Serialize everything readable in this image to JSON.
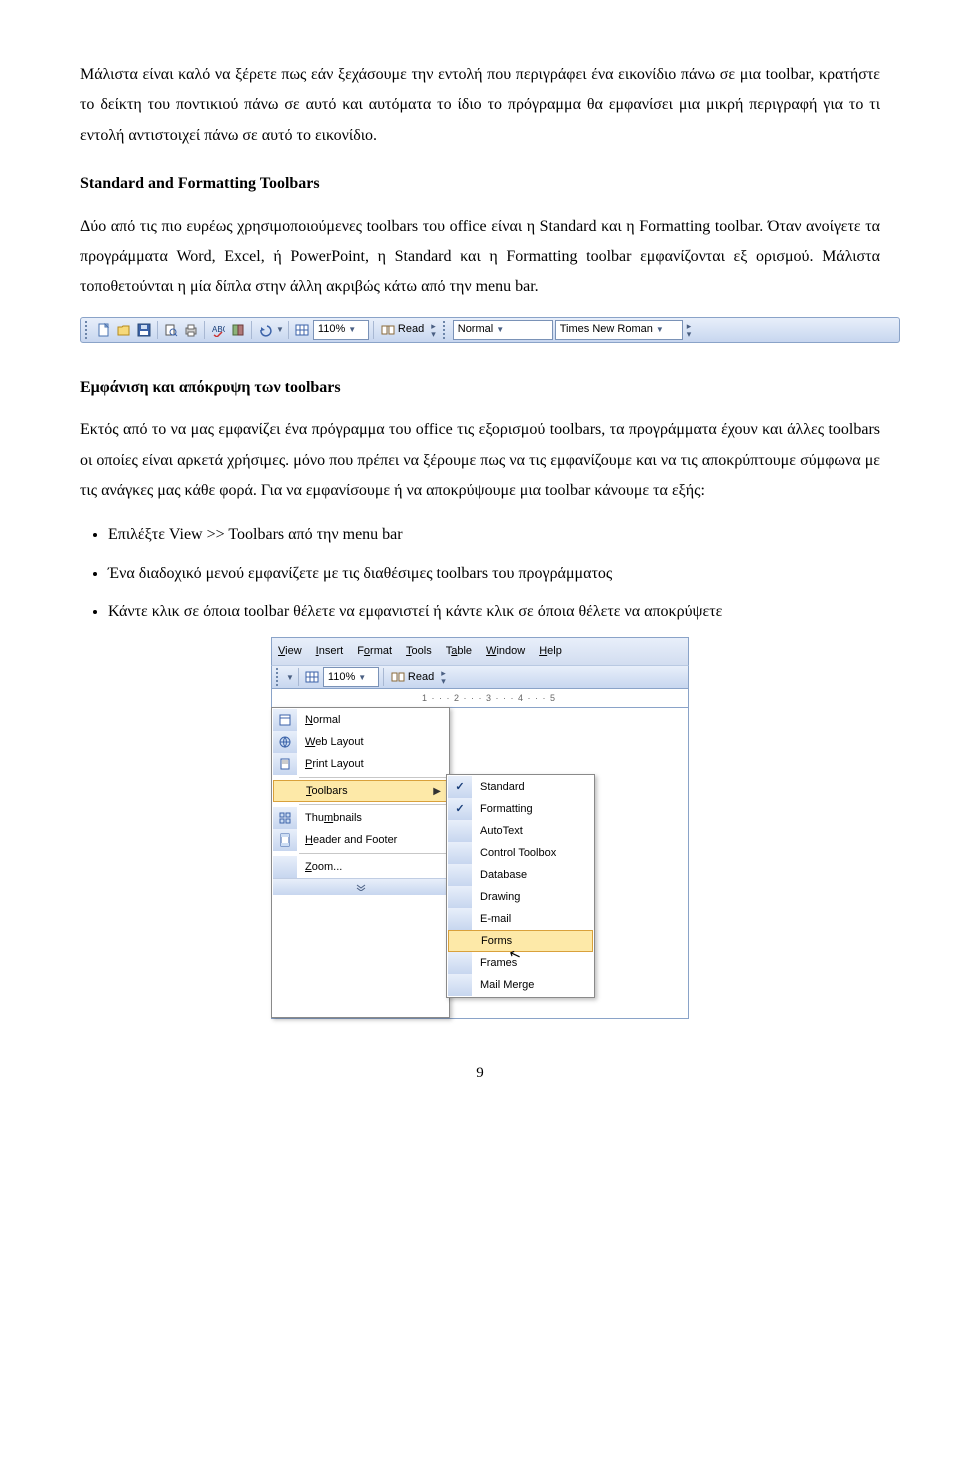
{
  "paragraphs": {
    "p1": "Μάλιστα είναι καλό να ξέρετε πως εάν ξεχάσουμε την εντολή που περιγράφει ένα εικονίδιο πάνω σε μια toolbar, κρατήστε το δείκτη του ποντικιού πάνω σε αυτό και αυτόματα το ίδιο το πρόγραμμα θα εμφανίσει μια μικρή περιγραφή για το τι εντολή αντιστοιχεί πάνω σε αυτό το εικονίδιο.",
    "heading1": "Standard and Formatting Toolbars",
    "p2": "Δύο από τις πιο ευρέως χρησιμοποιούμενες toolbars του office είναι η Standard και η Formatting toolbar. Όταν ανοίγετε τα προγράμματα Word, Excel, ή PowerPoint, η Standard και η Formatting toolbar εμφανίζονται εξ ορισμού. Μάλιστα τοποθετούνται η μία δίπλα στην άλλη ακριβώς κάτω από την menu bar.",
    "heading2": "Εμφάνιση και απόκρυψη των toolbars",
    "p3": "Εκτός από το να μας εμφανίζει ένα πρόγραμμα του office τις εξορισμού toolbars, τα προγράμματα έχουν και άλλες toolbars οι οποίες είναι αρκετά χρήσιμες. μόνο που πρέπει να ξέρουμε πως να τις εμφανίζουμε και να τις αποκρύπτουμε σύμφωνα με τις ανάγκες μας κάθε φορά. Για να εμφανίσουμε ή να αποκρύψουμε μια toolbar κάνουμε τα εξής:",
    "li1": "Επιλέξτε View >> Toolbars από την menu bar",
    "li2": "Ένα διαδοχικό μενού εμφανίζετε με τις διαθέσιμες toolbars του προγράμματος",
    "li3": "Κάντε κλικ σε όποια toolbar θέλετε να εμφανιστεί ή κάντε κλικ σε όποια θέλετε να αποκρύψετε"
  },
  "toolbar": {
    "zoom": "110%",
    "read": "Read",
    "style": "Normal",
    "font": "Times New Roman"
  },
  "menubar": {
    "view": "View",
    "insert": "Insert",
    "format": "Format",
    "tools": "Tools",
    "table": "Table",
    "window": "Window",
    "help": "Help"
  },
  "mini_toolbar": {
    "zoom": "110%",
    "read": "Read"
  },
  "ruler": "1 · · · 2 · · · 3 · · · 4 · · · 5",
  "view_menu": {
    "normal": "Normal",
    "web": "Web Layout",
    "print": "Print Layout",
    "toolbars": "Toolbars",
    "thumbs": "Thumbnails",
    "headerfooter": "Header and Footer",
    "zoom": "Zoom..."
  },
  "submenu": {
    "standard": "Standard",
    "formatting": "Formatting",
    "autotext": "AutoText",
    "controltoolbox": "Control Toolbox",
    "database": "Database",
    "drawing": "Drawing",
    "email": "E-mail",
    "forms": "Forms",
    "frames": "Frames",
    "mailmerge": "Mail Merge"
  },
  "page_number": "9"
}
